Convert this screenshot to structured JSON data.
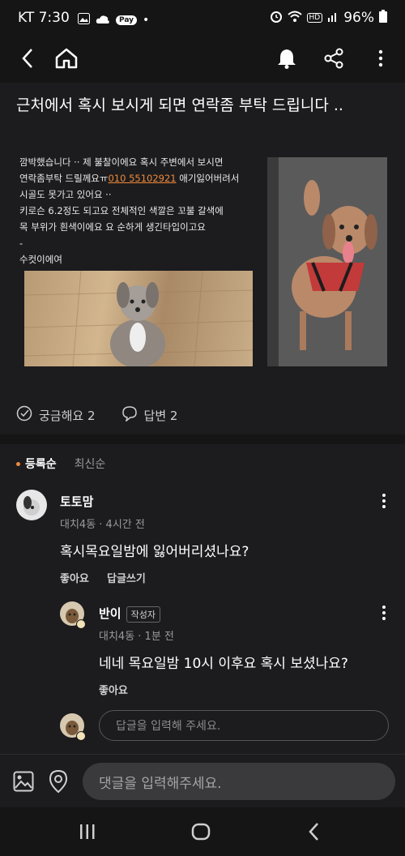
{
  "status_bar": {
    "carrier_time": "KT 7:30",
    "battery": "96%",
    "icons": [
      "gallery-icon",
      "cloud-icon",
      "pay-icon",
      "alarm-icon",
      "wifi-icon",
      "hd-icon",
      "signal-icon",
      "battery-icon"
    ]
  },
  "topbar": {
    "icons": [
      "back-icon",
      "home-icon",
      "bell-icon",
      "share-icon",
      "more-icon"
    ]
  },
  "post": {
    "title": "근처에서 혹시 보시게 되면 연락좀 부탁 드립니다 ..",
    "notice_lines": [
      "깜박했습니다 ·· 제 불찰이에요 혹시 주변에서 보시면",
      "연락좀부탁 드릴께요ㅠ",
      "010 55102921",
      " 애기잃어버려서",
      "시골도 못가고 있어요 ··",
      "키로슨 6.2정도 되고요 전체적인 색깔은 꼬불 갈색에",
      "목 부위가 흰색이에요 요 순하게 생긴타입이고요",
      "-",
      "수컷이에여"
    ],
    "curious_label": "궁금해요 2",
    "answer_label": "답변 2"
  },
  "sort": {
    "registered": "등록순",
    "latest": "최신순"
  },
  "comments": [
    {
      "author": "토토맘",
      "meta": "대치4동 · 4시간 전",
      "text": "혹시목요일밤에 잃어버리셨나요?",
      "like": "좋아요",
      "reply": "답글쓰기"
    },
    {
      "author": "반이",
      "badge": "작성자",
      "meta": "대치4동 · 1분 전",
      "text": "네네 목요일밤 10시 이후요 혹시 보셨나요?",
      "like": "좋아요"
    }
  ],
  "reply_input": {
    "placeholder": "답글을 입력해 주세요."
  },
  "comment_input": {
    "placeholder": "댓글을 입력해주세요."
  },
  "colors": {
    "accent": "#f08a3a",
    "background": "#1c1c1e"
  }
}
